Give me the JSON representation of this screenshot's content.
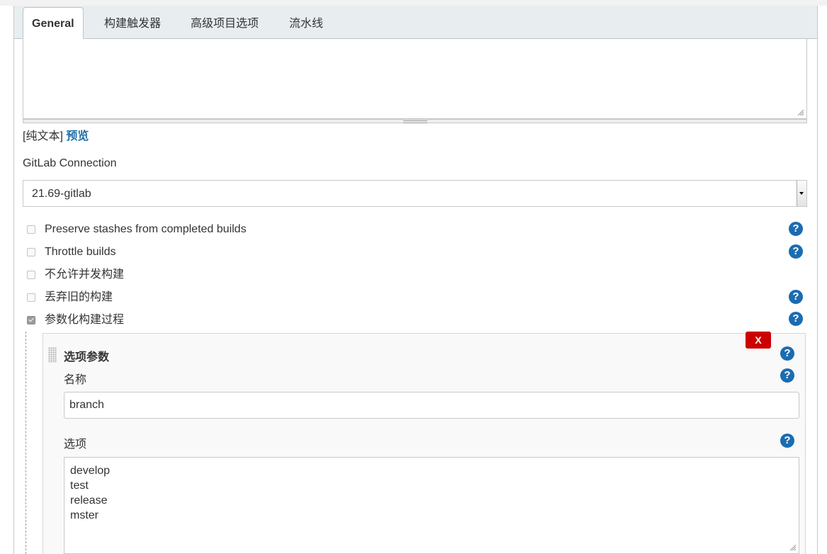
{
  "tabs": [
    {
      "label": "General",
      "active": true
    },
    {
      "label": "构建触发器",
      "active": false
    },
    {
      "label": "高级项目选项",
      "active": false
    },
    {
      "label": "流水线",
      "active": false
    }
  ],
  "description": {
    "plain_text_label": "[纯文本]",
    "preview_link": "预览"
  },
  "gitlab": {
    "label": "GitLab Connection",
    "selected": "21.69-gitlab"
  },
  "options": [
    {
      "label": "Preserve stashes from completed builds",
      "checked": false,
      "help": true
    },
    {
      "label": "Throttle builds",
      "checked": false,
      "help": true
    },
    {
      "label": "不允许并发构建",
      "checked": false,
      "help": false
    },
    {
      "label": "丢弃旧的构建",
      "checked": false,
      "help": true
    },
    {
      "label": "参数化构建过程",
      "checked": true,
      "help": true
    }
  ],
  "parameter": {
    "delete_label": "X",
    "title": "选项参数",
    "name_label": "名称",
    "name_value": "branch",
    "choices_label": "选项",
    "choices": [
      "develop",
      "test",
      "release",
      "mster"
    ]
  },
  "help_glyph": "?",
  "colors": {
    "link": "#1f6fa8",
    "help_icon": "#1b6cb1",
    "delete_button": "#cc0000",
    "tab_bar": "#e8edf0"
  }
}
